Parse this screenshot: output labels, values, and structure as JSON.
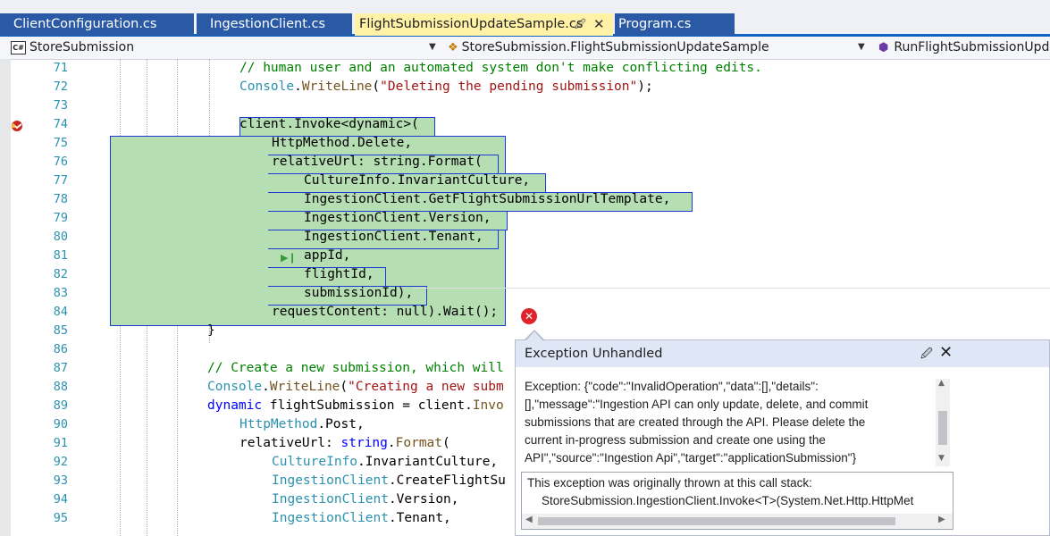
{
  "tabs": [
    {
      "label": "ClientConfiguration.cs",
      "active": false
    },
    {
      "label": "IngestionClient.cs",
      "active": false
    },
    {
      "label": "FlightSubmissionUpdateSample.cs",
      "active": true
    },
    {
      "label": "Program.cs",
      "active": false
    }
  ],
  "nav": {
    "project": "StoreSubmission",
    "type": "StoreSubmission.FlightSubmissionUpdateSample",
    "member": "RunFlightSubmissionUpda"
  },
  "line_numbers": [
    "71",
    "72",
    "73",
    "74",
    "75",
    "76",
    "77",
    "78",
    "79",
    "80",
    "81",
    "82",
    "83",
    "84",
    "85",
    "86",
    "87",
    "88",
    "89",
    "90",
    "91",
    "92",
    "93",
    "94",
    "95"
  ],
  "code": {
    "l71": "// human user and an automated system don't make conflicting edits.",
    "l72_a": "Console",
    "l72_b": ".",
    "l72_c": "WriteLine",
    "l72_d": "(",
    "l72_e": "\"Deleting the pending submission\"",
    "l72_f": ");",
    "l74": "client.Invoke<dynamic>(",
    "l75": "HttpMethod.Delete,",
    "l76": "relativeUrl: string.Format(",
    "l77": "CultureInfo.InvariantCulture,",
    "l78": "IngestionClient.GetFlightSubmissionUrlTemplate,",
    "l79": "IngestionClient.Version,",
    "l80": "IngestionClient.Tenant,",
    "l81": "appId,",
    "l82": "flightId,",
    "l83": "submissionId),",
    "l84": "requestContent: null).Wait();",
    "l85": "}",
    "l87": "// Create a new submission, which will",
    "l88_a": "Console",
    "l88_b": ".",
    "l88_c": "WriteLine",
    "l88_d": "(",
    "l88_e": "\"Creating a new subm",
    "l89_a": "dynamic",
    "l89_b": " flightSubmission = client.",
    "l89_c": "Invo",
    "l90_a": "HttpMethod",
    "l90_b": ".Post,",
    "l91_a": "relativeUrl: ",
    "l91_b": "string",
    "l91_c": ".",
    "l91_d": "Format",
    "l91_e": "(",
    "l92_a": "CultureInfo",
    "l92_b": ".InvariantCulture,",
    "l93_a": "IngestionClient",
    "l93_b": ".CreateFlightSu",
    "l94_a": "IngestionClient",
    "l94_b": ".Version,",
    "l95_a": "IngestionClient",
    "l95_b": ".Tenant,"
  },
  "exception_popup": {
    "title": "Exception Unhandled",
    "message_lines": [
      "Exception: {\"code\":\"InvalidOperation\",\"data\":[],\"details\":",
      "[],\"message\":\"Ingestion API can only update, delete, and commit",
      "submissions that are created through the API. Please delete the",
      "current in-progress submission and create one using the",
      "API\",\"source\":\"Ingestion Api\",\"target\":\"applicationSubmission\"}"
    ],
    "stack_title": "This exception was originally thrown at this call stack:",
    "stack_line": "StoreSubmission.IngestionClient.Invoke<T>(System.Net.Http.HttpMet"
  },
  "colors": {
    "tab_active": "#fff1a6",
    "tab_inactive": "#2a5aa6",
    "highlight": "#b5deb3",
    "error": "#e0252a"
  },
  "icons": {
    "pin": "pin-icon",
    "close": "close-icon",
    "error": "error-icon",
    "breakpoint": "exception-breakpoint-icon",
    "next_statement": "next-statement-icon"
  }
}
